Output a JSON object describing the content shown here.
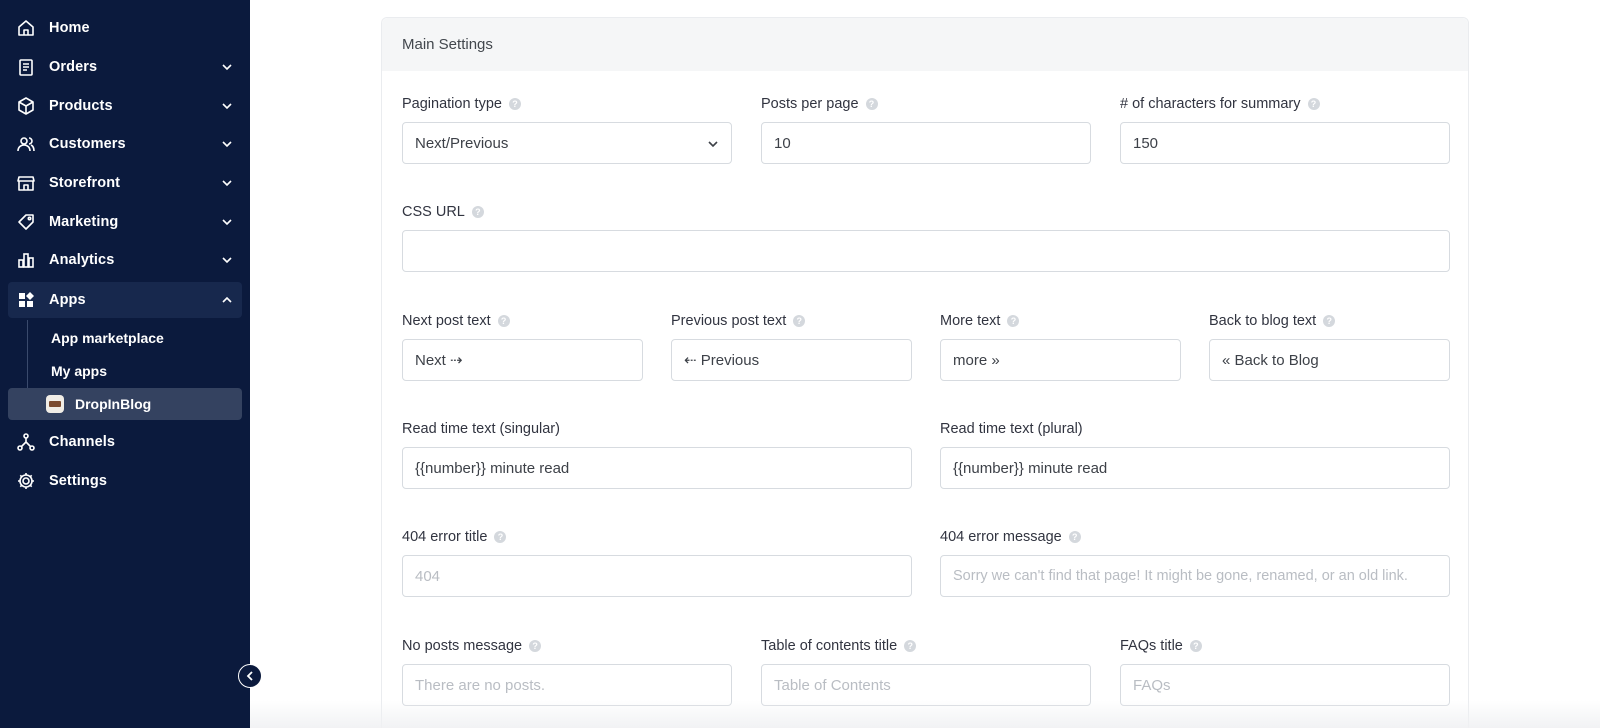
{
  "sidebar": {
    "items": [
      {
        "label": "Home",
        "icon": "home-icon"
      },
      {
        "label": "Orders",
        "icon": "orders-icon"
      },
      {
        "label": "Products",
        "icon": "products-icon"
      },
      {
        "label": "Customers",
        "icon": "customers-icon"
      },
      {
        "label": "Storefront",
        "icon": "storefront-icon"
      },
      {
        "label": "Marketing",
        "icon": "marketing-icon"
      },
      {
        "label": "Analytics",
        "icon": "analytics-icon"
      },
      {
        "label": "Apps",
        "icon": "apps-icon"
      },
      {
        "label": "Channels",
        "icon": "channels-icon"
      },
      {
        "label": "Settings",
        "icon": "settings-icon"
      }
    ],
    "apps_subitems": [
      {
        "label": "App marketplace"
      },
      {
        "label": "My apps"
      },
      {
        "label": "DropInBlog"
      }
    ]
  },
  "main_settings": {
    "title": "Main Settings",
    "pagination_type": {
      "label": "Pagination type",
      "value": "Next/Previous"
    },
    "posts_per_page": {
      "label": "Posts per page",
      "value": "10"
    },
    "summary_chars": {
      "label": "# of characters for summary",
      "value": "150"
    },
    "css_url": {
      "label": "CSS URL",
      "value": ""
    },
    "next_post_text": {
      "label": "Next post text",
      "value": "Next ⇢"
    },
    "previous_post_text": {
      "label": "Previous post text",
      "value": "⇠ Previous"
    },
    "more_text": {
      "label": "More text",
      "value": "more »"
    },
    "back_to_blog_text": {
      "label": "Back to blog text",
      "value": "« Back to Blog"
    },
    "read_time_singular": {
      "label": "Read time text (singular)",
      "value": "{{number}} minute read"
    },
    "read_time_plural": {
      "label": "Read time text (plural)",
      "value": "{{number}} minute read"
    },
    "error_404_title": {
      "label": "404 error title",
      "placeholder": "404"
    },
    "error_404_message": {
      "label": "404 error message",
      "placeholder": "Sorry we can't find that page! It might be gone, renamed, or an old link."
    },
    "no_posts_message": {
      "label": "No posts message",
      "placeholder": "There are no posts."
    },
    "toc_title": {
      "label": "Table of contents title",
      "placeholder": "Table of Contents"
    },
    "faqs_title": {
      "label": "FAQs title",
      "placeholder": "FAQs"
    }
  },
  "help_glyph": "?",
  "colors": {
    "sidebar_bg": "#0b1a3d",
    "active_bg": "#17284d",
    "selected_bg": "#344260"
  }
}
